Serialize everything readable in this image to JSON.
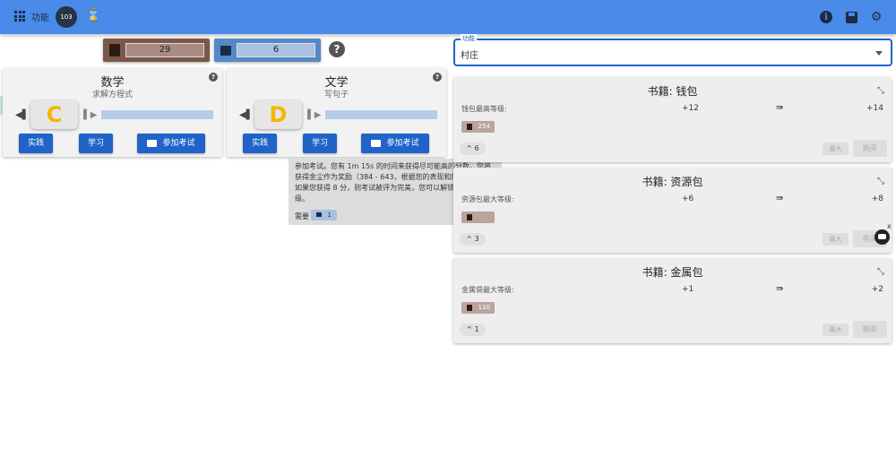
{
  "topbar": {
    "menu_label": "功能",
    "gear_badge": "103",
    "hourglass_icon": "⌛",
    "right_icons": [
      "info-icon",
      "save-icon",
      "gear-icon"
    ]
  },
  "resources": {
    "book_value": "29",
    "card_value": "6"
  },
  "subjects": [
    {
      "title": "数学",
      "subtitle": "求解方程式",
      "grade": "C",
      "practice_label": "实践",
      "study_label": "学习",
      "exam_label": "参加考试"
    },
    {
      "title": "文学",
      "subtitle": "写句子",
      "grade": "D",
      "practice_label": "实践",
      "study_label": "学习",
      "exam_label": "参加考试"
    }
  ],
  "tooltip": {
    "text": "参加考试。您有 1m 15s 的时间来获得尽可能高的分数。您将获得金尘作为奖励（384 - 643，根据您的表现和所选等级）。如果您获得 8 分，则考试被评为完美，您可以解锁下一个等级。",
    "req_label": "需要",
    "req_value": "1"
  },
  "select": {
    "label": "功能",
    "value": "村庄"
  },
  "books": [
    {
      "title": "书籍: 钱包",
      "stat": "钱包最高等级:",
      "from": "+12",
      "arrow": "⇛",
      "to": "+14",
      "cost": "254",
      "level": "6",
      "max_label": "最大",
      "buy_label": "购买"
    },
    {
      "title": "书籍: 资源包",
      "stat": "资源包最大等级:",
      "from": "+6",
      "arrow": "⇛",
      "to": "+8",
      "cost": "",
      "level": "3",
      "max_label": "最大",
      "buy_label": "购买"
    },
    {
      "title": "书籍: 金属包",
      "stat": "金属袋最大等级:",
      "from": "+1",
      "arrow": "⇛",
      "to": "+2",
      "cost": "110",
      "level": "1",
      "max_label": "最大",
      "buy_label": "购买"
    }
  ]
}
